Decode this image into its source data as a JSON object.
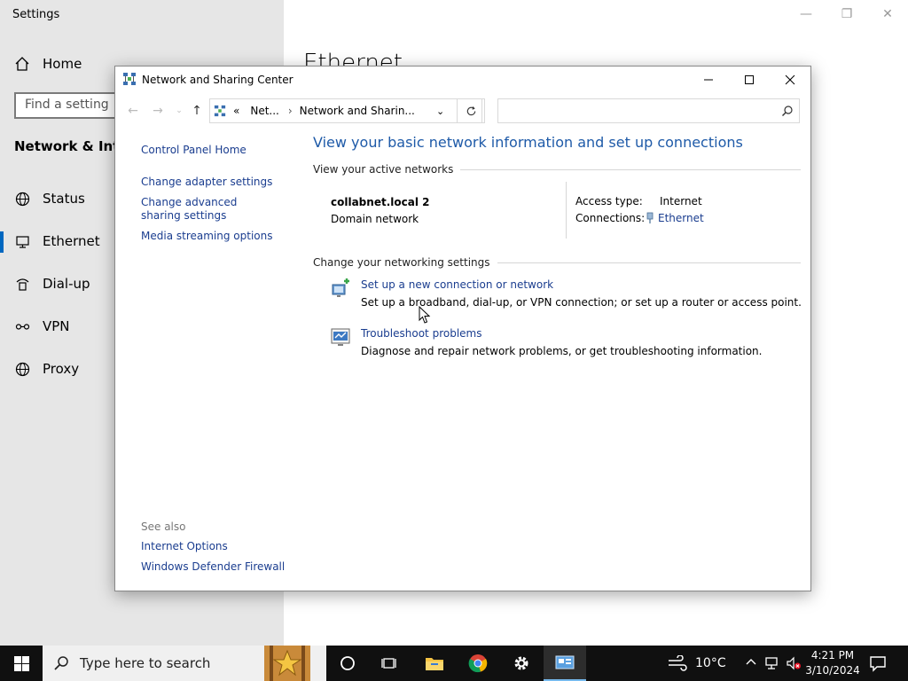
{
  "settings": {
    "title": "Settings",
    "home_label": "Home",
    "find_placeholder": "Find a setting",
    "section_label": "Network & Interne",
    "nav": [
      {
        "label": "Status",
        "icon": "globe-icon"
      },
      {
        "label": "Ethernet",
        "icon": "monitor-icon"
      },
      {
        "label": "Dial-up",
        "icon": "dialup-icon"
      },
      {
        "label": "VPN",
        "icon": "vpn-icon"
      },
      {
        "label": "Proxy",
        "icon": "globe-icon"
      }
    ],
    "page_heading": "Ethernet"
  },
  "window": {
    "title": "Network and Sharing Center",
    "address": {
      "overflow": "«",
      "crumb1": "Net...",
      "crumb2": "Network and Sharin..."
    },
    "left_links": {
      "home": "Control Panel Home",
      "adapter": "Change adapter settings",
      "advanced": "Change advanced sharing settings",
      "media": "Media streaming options"
    },
    "main_title": "View your basic network information and set up connections",
    "active_networks_heading": "View your active networks",
    "network": {
      "name": "collabnet.local 2",
      "type": "Domain network",
      "access_type_key": "Access type:",
      "access_type_value": "Internet",
      "connections_key": "Connections:",
      "connections_value": "Ethernet"
    },
    "settings_heading": "Change your networking settings",
    "tasks": [
      {
        "link": "Set up a new connection or network",
        "desc": "Set up a broadband, dial-up, or VPN connection; or set up a router or access point."
      },
      {
        "link": "Troubleshoot problems",
        "desc": "Diagnose and repair network problems, or get troubleshooting information."
      }
    ],
    "see_also": {
      "heading": "See also",
      "internet_options": "Internet Options",
      "firewall": "Windows Defender Firewall"
    }
  },
  "taskbar": {
    "search_placeholder": "Type here to search",
    "temperature": "10°C",
    "time": "4:21 PM",
    "date": "3/10/2024"
  }
}
